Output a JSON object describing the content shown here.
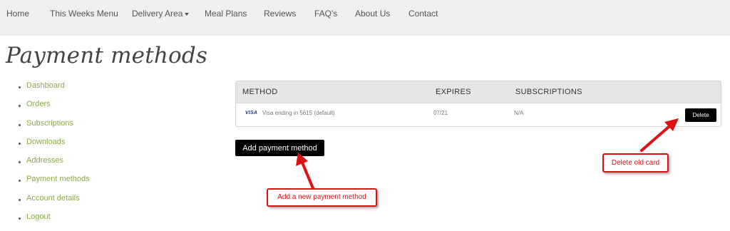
{
  "nav": {
    "items": [
      {
        "label": "Home"
      },
      {
        "label": "This Weeks Menu"
      },
      {
        "label": "Delivery Area"
      },
      {
        "label": "Meal Plans"
      },
      {
        "label": "Reviews"
      },
      {
        "label": "FAQ's"
      },
      {
        "label": "About Us"
      },
      {
        "label": "Contact"
      }
    ]
  },
  "page": {
    "title": "Payment methods"
  },
  "sidebar": {
    "items": [
      {
        "label": "Dashboard"
      },
      {
        "label": "Orders"
      },
      {
        "label": "Subscriptions"
      },
      {
        "label": "Downloads"
      },
      {
        "label": "Addresses"
      },
      {
        "label": "Payment methods"
      },
      {
        "label": "Account details"
      },
      {
        "label": "Logout"
      }
    ]
  },
  "table": {
    "headers": {
      "method": "METHOD",
      "expires": "EXPIRES",
      "subscriptions": "SUBSCRIPTIONS"
    },
    "rows": [
      {
        "brand": "VISA",
        "method": "Visa ending in 5615 (default)",
        "expires": "07/21",
        "subscriptions": "N/A",
        "delete_label": "Delete"
      }
    ]
  },
  "actions": {
    "add_label": "Add payment method"
  },
  "annotations": {
    "add_note": "Add a new payment method",
    "delete_note": "Delete old card"
  },
  "colors": {
    "nav_bg": "#efefef",
    "link": "#8ba94a",
    "button_bg": "#000000",
    "annotation": "#dd1111"
  }
}
